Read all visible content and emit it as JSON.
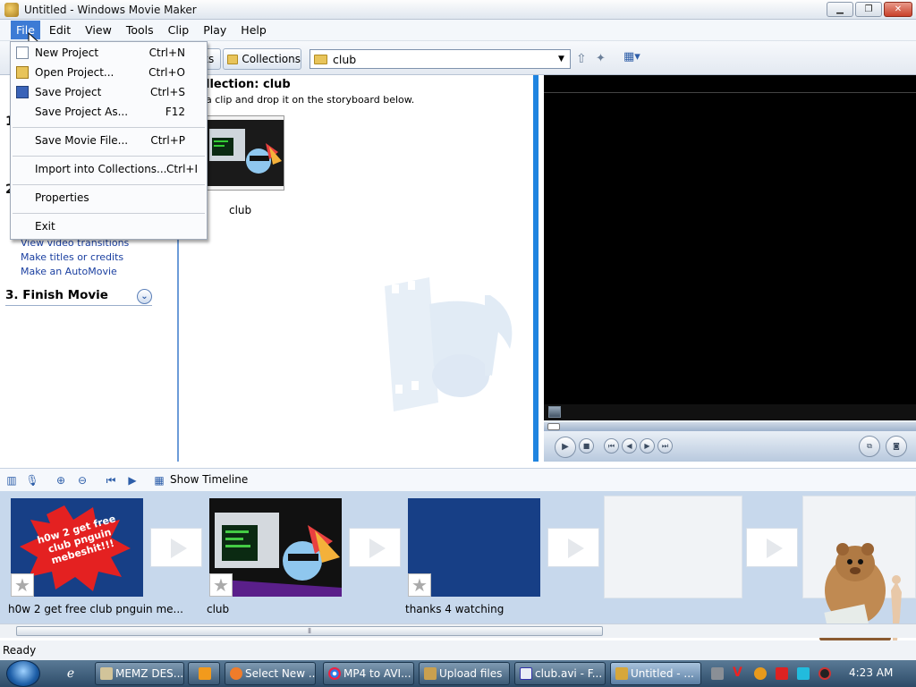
{
  "window": {
    "title": "Untitled - Windows Movie Maker",
    "min_glyph": "▁",
    "max_glyph": "❐",
    "close_glyph": "✕"
  },
  "menubar": {
    "file": "File",
    "edit": "Edit",
    "view": "View",
    "tools": "Tools",
    "clip": "Clip",
    "play": "Play",
    "help": "Help"
  },
  "toolbar": {
    "tasks_label": "ks",
    "collections_label": "Collections",
    "collection_selected": "club",
    "combo_arrow": "▼"
  },
  "file_menu": {
    "items": [
      {
        "label": "New Project",
        "shortcut": "Ctrl+N"
      },
      {
        "label": "Open Project...",
        "shortcut": "Ctrl+O"
      },
      {
        "label": "Save Project",
        "shortcut": "Ctrl+S"
      },
      {
        "label": "Save Project As...",
        "shortcut": "F12"
      },
      {
        "label": "Save Movie File...",
        "shortcut": "Ctrl+P"
      },
      {
        "label": "Import into Collections...",
        "shortcut": "Ctrl+I"
      },
      {
        "label": "Properties",
        "shortcut": ""
      },
      {
        "label": "Exit",
        "shortcut": ""
      }
    ]
  },
  "tasks": {
    "step1_num": "1",
    "step2_num": "2",
    "links": [
      "View video transitions",
      "Make titles or credits",
      "Make an AutoMovie"
    ],
    "finish": "3. Finish Movie",
    "expand_glyph": "⌄"
  },
  "collection": {
    "title": "llection: club",
    "subtitle": "a clip and drop it on the storyboard below.",
    "clip_label": "club"
  },
  "storyboard_toolbar": {
    "show_timeline": "Show Timeline"
  },
  "storyboard": {
    "clips": [
      {
        "label": "h0w 2 get free club pnguin me...",
        "overlay": "h0w 2 get free club pnguin mebeshit!!!"
      },
      {
        "label": "club"
      },
      {
        "label": "thanks 4 watching"
      }
    ]
  },
  "status": {
    "text": "Ready"
  },
  "taskbar": {
    "buttons": [
      "MEMZ DES...",
      "Select New ...",
      "MP4 to AVI...",
      "Upload files",
      "club.avi - F...",
      "Untitled - ..."
    ],
    "clock": "4:23 AM"
  },
  "colors": {
    "accent": "#1f84e0",
    "menu_highlight": "#3d7bd5",
    "storyboard_bg": "#c7d8ec",
    "clip_blue": "#173f86"
  }
}
